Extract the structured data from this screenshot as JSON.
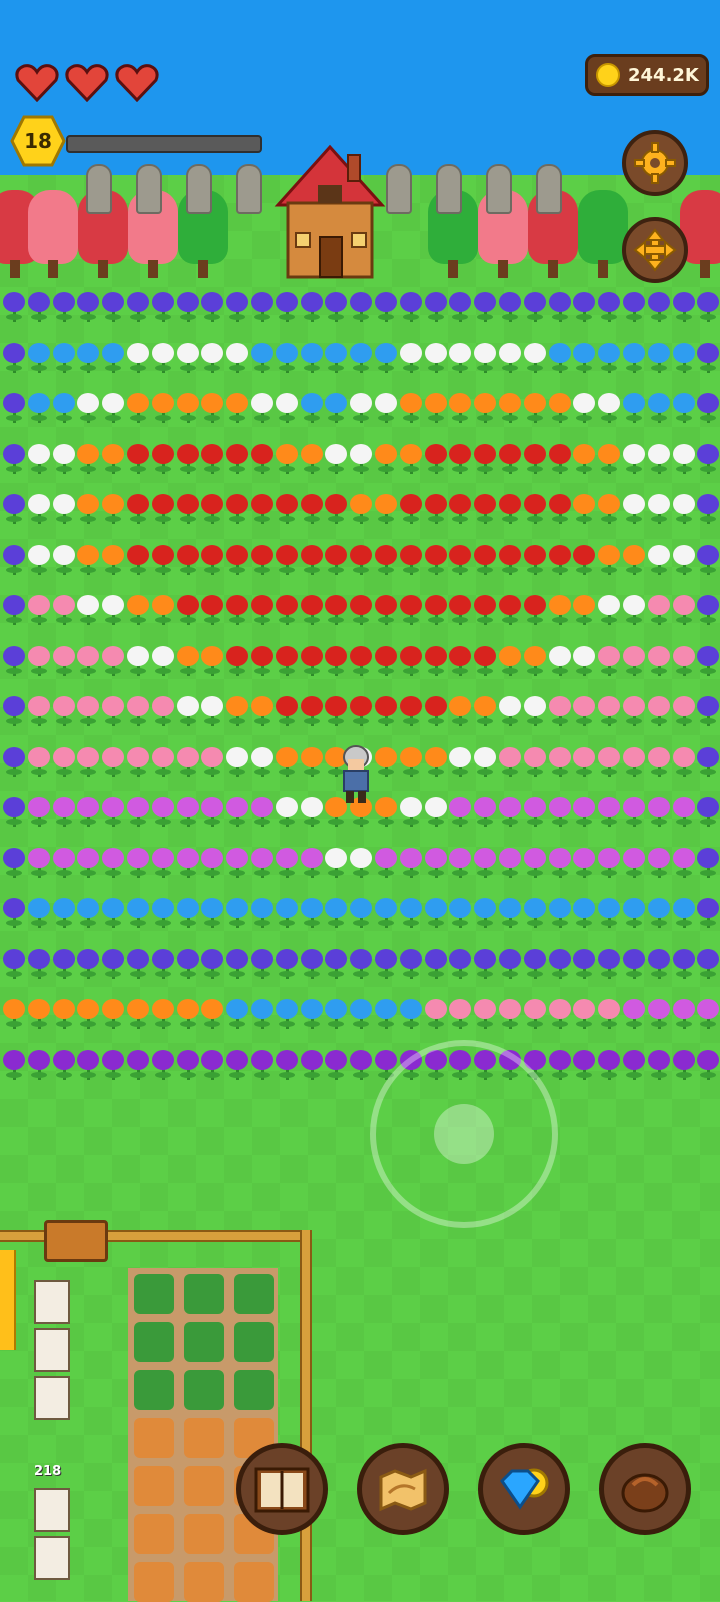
{
  "hud": {
    "hearts": [
      {
        "icon": "heart-icon",
        "state": "full"
      },
      {
        "icon": "heart-icon",
        "state": "full"
      },
      {
        "icon": "heart-icon",
        "state": "full"
      }
    ],
    "level": "18",
    "xp_fraction": 0.0,
    "coins": "244.2K"
  },
  "buttons": {
    "settings": "gear-icon",
    "move_mode": "move-arrows-icon"
  },
  "pen": {
    "hive_count": "218"
  },
  "toolbar": [
    {
      "id": "journal",
      "icon": "book-icon"
    },
    {
      "id": "map",
      "icon": "map-scroll-icon"
    },
    {
      "id": "shop",
      "icon": "gem-coin-icon"
    },
    {
      "id": "bag",
      "icon": "bag-icon"
    }
  ],
  "colors": {
    "sky": "#1e96ee",
    "grass": "#5ccf47",
    "coin": "#ffd21a",
    "wood": "#6b4128",
    "heart": "#e2453a"
  }
}
